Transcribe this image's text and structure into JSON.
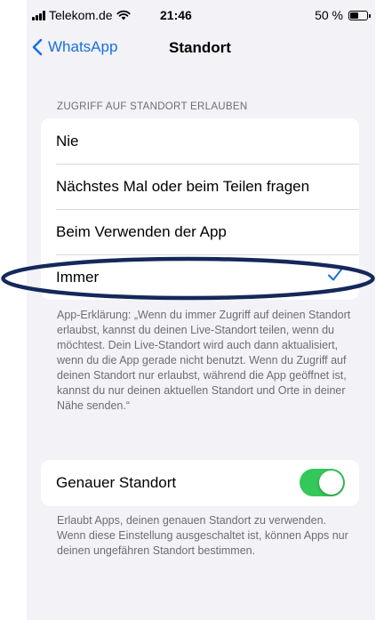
{
  "status_bar": {
    "carrier": "Telekom.de",
    "time": "21:46",
    "battery": "50 %",
    "battery_level": 0.5
  },
  "nav": {
    "back_label": "WhatsApp",
    "title": "Standort"
  },
  "location_access": {
    "header": "ZUGRIFF AUF STANDORT ERLAUBEN",
    "options": [
      {
        "label": "Nie",
        "selected": false
      },
      {
        "label": "Nächstes Mal oder beim Teilen fragen",
        "selected": false
      },
      {
        "label": "Beim Verwenden der App",
        "selected": false
      },
      {
        "label": "Immer",
        "selected": true
      }
    ],
    "explanation": "App-Erklärung: „Wenn du immer Zugriff auf deinen Standort erlaubst, kannst du deinen Live-Standort teilen, wenn du möchtest. Dein Live-Standort wird auch dann aktualisiert, wenn du die App gerade nicht benutzt. Wenn du Zugriff auf deinen Standort nur erlaubst, während die App geöffnet ist, kannst du nur deinen aktuellen Standort und Orte in deiner Nähe senden.“"
  },
  "precise_location": {
    "label": "Genauer Standort",
    "enabled": true,
    "description": "Erlaubt Apps, deinen genauen Standort zu verwenden. Wenn diese Einstellung ausgeschaltet ist, können Apps nur deinen ungefähren Standort bestimmen."
  },
  "colors": {
    "accent": "#1a6fe0",
    "toggle_on": "#34c759",
    "background": "#f2f2f7",
    "annotation": "#14285a"
  }
}
